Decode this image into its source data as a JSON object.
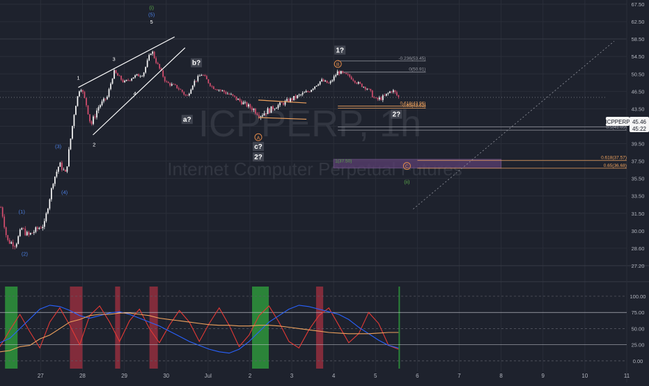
{
  "colors": {
    "background": "#1e222d",
    "grid": "#2a2e39",
    "up_candle": "#f7f7f7",
    "down_candle": "#d24d6d",
    "wave_line": "#ffffff",
    "fib_line": "#9598a1",
    "fib_orange": "#f0a35e",
    "target_box": "#5a3f72",
    "blue_wave_label": "#4a7ee0",
    "green_wave_label": "#5ba84a",
    "orange_wave_label": "#e08a4a",
    "osc_red": "#e53935",
    "osc_blue": "#2962ff",
    "osc_orange": "#f0a35e",
    "osc_band_green": "#2e9e3c",
    "osc_band_red": "#9b2f3f",
    "osc_band_gray": "#7a7d88",
    "price_tag_bg": "#f5f5f5"
  },
  "watermark": {
    "symbol": "ICPPERP, 1h",
    "description": "Internet Computer Perpetual Futures"
  },
  "price_tag": {
    "symbol": "ICPPERP",
    "price": "45.46",
    "countdown": "45:22"
  },
  "chart_data": [
    {
      "type": "candlestick",
      "pane": "main",
      "ylim": [
        27.2,
        67.5
      ],
      "y_ticks": [
        27.2,
        28.6,
        30.0,
        31.5,
        33.5,
        35.5,
        37.5,
        39.5,
        41.5,
        43.5,
        46.5,
        50.5,
        54.5,
        58.5,
        62.5,
        67.5
      ],
      "y_tick_labels": [
        "27.20",
        "28.60",
        "30.00",
        "31.50",
        "33.50",
        "35.50",
        "37.50",
        "39.50",
        "41.50",
        "43.50",
        "46.50",
        "50.50",
        "54.50",
        "58.50",
        "62.50",
        "67.50"
      ],
      "x_tick_labels": [
        "27",
        "28",
        "29",
        "30",
        "Jul",
        "2",
        "3",
        "4",
        "5",
        "6",
        "7",
        "8",
        "9",
        "10",
        "11"
      ],
      "x_tick_days": [
        0,
        1,
        2,
        3,
        4,
        5,
        6,
        7,
        8,
        9,
        10,
        11,
        12,
        13,
        14
      ],
      "x_range_days": [
        -0.97,
        14.0
      ],
      "price_path": [
        {
          "day": -0.95,
          "price": 32.2
        },
        {
          "day": -0.8,
          "price": 29.2
        },
        {
          "day": -0.6,
          "price": 28.9
        },
        {
          "day": -0.45,
          "price": 30.2
        },
        {
          "day": -0.3,
          "price": 29.6
        },
        {
          "day": -0.1,
          "price": 30.1
        },
        {
          "day": 0.1,
          "price": 30.6
        },
        {
          "day": 0.3,
          "price": 35.2
        },
        {
          "day": 0.45,
          "price": 37.2
        },
        {
          "day": 0.6,
          "price": 36.0
        },
        {
          "day": 0.8,
          "price": 43.0
        },
        {
          "day": 0.95,
          "price": 47.6
        },
        {
          "day": 1.2,
          "price": 41.6
        },
        {
          "day": 1.4,
          "price": 44.0
        },
        {
          "day": 1.6,
          "price": 45.6
        },
        {
          "day": 1.75,
          "price": 51.0
        },
        {
          "day": 2.0,
          "price": 48.5
        },
        {
          "day": 2.2,
          "price": 49.8
        },
        {
          "day": 2.45,
          "price": 50.5
        },
        {
          "day": 2.65,
          "price": 56.0
        },
        {
          "day": 2.75,
          "price": 53.5
        },
        {
          "day": 3.0,
          "price": 48.5
        },
        {
          "day": 3.25,
          "price": 47.5
        },
        {
          "day": 3.5,
          "price": 45.5
        },
        {
          "day": 3.65,
          "price": 48.5
        },
        {
          "day": 3.85,
          "price": 50.5
        },
        {
          "day": 4.1,
          "price": 47.5
        },
        {
          "day": 4.5,
          "price": 46.0
        },
        {
          "day": 4.9,
          "price": 44.2
        },
        {
          "day": 5.25,
          "price": 42.8
        },
        {
          "day": 5.5,
          "price": 43.5
        },
        {
          "day": 5.8,
          "price": 44.5
        },
        {
          "day": 6.1,
          "price": 45.5
        },
        {
          "day": 6.4,
          "price": 46.5
        },
        {
          "day": 6.7,
          "price": 49.0
        },
        {
          "day": 6.9,
          "price": 48.2
        },
        {
          "day": 7.1,
          "price": 51.0
        },
        {
          "day": 7.4,
          "price": 49.8
        },
        {
          "day": 7.6,
          "price": 48.2
        },
        {
          "day": 7.8,
          "price": 47.2
        },
        {
          "day": 8.0,
          "price": 45.0
        },
        {
          "day": 8.2,
          "price": 45.5
        },
        {
          "day": 8.4,
          "price": 46.8
        },
        {
          "day": 8.55,
          "price": 45.46
        }
      ],
      "wave_labels": [
        {
          "text": "(1)",
          "day": -0.45,
          "price": 31.5,
          "color_key": "blue_wave_label"
        },
        {
          "text": "(2)",
          "day": -0.38,
          "price": 28.0,
          "color_key": "blue_wave_label"
        },
        {
          "text": "(3)",
          "day": 0.42,
          "price": 39.0,
          "color_key": "blue_wave_label"
        },
        {
          "text": "(4)",
          "day": 0.57,
          "price": 33.7,
          "color_key": "blue_wave_label"
        },
        {
          "text": "(5)",
          "day": 2.65,
          "price": 64.0,
          "color_key": "blue_wave_label"
        },
        {
          "text": "(i)",
          "day": 2.65,
          "price": 66.0,
          "color_key": "green_wave_label"
        },
        {
          "text": "1",
          "day": 0.9,
          "price": 49.2,
          "color_key": "wave_line"
        },
        {
          "text": "2",
          "day": 1.28,
          "price": 39.2,
          "color_key": "wave_line"
        },
        {
          "text": "3",
          "day": 1.75,
          "price": 53.5,
          "color_key": "wave_line"
        },
        {
          "text": "4",
          "day": 2.25,
          "price": 45.8,
          "color_key": "wave_line"
        },
        {
          "text": "5",
          "day": 2.65,
          "price": 62.0,
          "color_key": "wave_line"
        },
        {
          "text": "A",
          "day": 5.2,
          "price": 40.0,
          "color_key": "orange_wave_label",
          "circled": true
        },
        {
          "text": "B",
          "day": 7.1,
          "price": 52.3,
          "color_key": "orange_wave_label",
          "circled": true
        },
        {
          "text": "C",
          "day": 8.75,
          "price": 36.7,
          "color_key": "orange_wave_label",
          "circled": true
        },
        {
          "text": "(ii)",
          "day": 8.75,
          "price": 34.9,
          "color_key": "green_wave_label"
        }
      ],
      "boxed_labels": [
        {
          "text": "a?",
          "day": 3.5,
          "price": 42.0
        },
        {
          "text": "b?",
          "day": 3.72,
          "price": 52.5
        },
        {
          "text": "c?",
          "day": 5.2,
          "price": 38.9
        },
        {
          "text": "2?",
          "day": 5.2,
          "price": 37.7
        },
        {
          "text": "1?",
          "day": 7.15,
          "price": 55.4
        },
        {
          "text": "2?",
          "day": 8.5,
          "price": 42.6
        }
      ],
      "fib_levels": [
        {
          "label": "-0.236(53.45)",
          "price": 53.45,
          "day_start": 7.1,
          "day_end": 9.2,
          "color_key": "fib_line"
        },
        {
          "label": "0(50.91)",
          "price": 50.91,
          "day_start": 7.1,
          "day_end": 9.2,
          "color_key": "fib_line"
        },
        {
          "label": "0.618(43.96)",
          "price": 43.96,
          "day_start": 7.1,
          "day_end": 9.2,
          "color_key": "fib_orange"
        },
        {
          "label": "0.65(43.62)",
          "price": 43.62,
          "day_start": 7.1,
          "day_end": 9.2,
          "color_key": "fib_orange"
        },
        {
          "label": "1(41.43)",
          "price": 41.43,
          "day_start": 7.1,
          "day_end": 14.0,
          "color_key": "fib_line"
        },
        {
          "label": "0.5(41.05)",
          "price": 41.05,
          "day_start": 7.1,
          "day_end": 14.0,
          "color_key": "fib_line"
        },
        {
          "label": "0.618(37.57)",
          "price": 37.57,
          "day_start": 9.0,
          "day_end": 14.0,
          "color_key": "fib_orange"
        },
        {
          "label": "0.65(36.68)",
          "price": 36.68,
          "day_start": 9.0,
          "day_end": 14.0,
          "color_key": "fib_orange"
        },
        {
          "label": "1(37.50)",
          "price": 37.2,
          "day_start": 7.0,
          "day_end": 7.0,
          "color_key": "green_wave_label"
        }
      ],
      "target_box": {
        "day_start": 7.0,
        "day_end": 11.0,
        "price_top": 37.7,
        "price_bottom": 36.7
      },
      "trend_lines": [
        {
          "from": {
            "day": 0.9,
            "price": 47.4
          },
          "to": {
            "day": 3.2,
            "price": 59.0
          },
          "color_key": "wave_line"
        },
        {
          "from": {
            "day": 1.25,
            "price": 40.5
          },
          "to": {
            "day": 3.45,
            "price": 56.5
          },
          "color_key": "wave_line"
        },
        {
          "from": {
            "day": 5.2,
            "price": 45.0
          },
          "to": {
            "day": 6.35,
            "price": 44.5
          },
          "color_key": "fib_orange"
        },
        {
          "from": {
            "day": 5.2,
            "price": 42.5
          },
          "to": {
            "day": 6.35,
            "price": 42.3
          },
          "color_key": "fib_orange"
        },
        {
          "from": {
            "day": 8.9,
            "price": 32.0
          },
          "to": {
            "day": 13.7,
            "price": 58.0
          },
          "color_key": "fib_line",
          "dashed": true
        }
      ]
    },
    {
      "type": "line",
      "pane": "oscillator",
      "ylim": [
        -12,
        115
      ],
      "y_ticks": [
        0,
        25,
        50,
        75,
        100
      ],
      "y_tick_labels": [
        "0.00",
        "25.00",
        "50.00",
        "75.00",
        "100.00"
      ],
      "series": [
        {
          "color_key": "osc_red",
          "values": [
            22,
            48,
            72,
            45,
            20,
            60,
            82,
            55,
            25,
            70,
            85,
            60,
            30,
            62,
            80,
            50,
            28,
            55,
            78,
            60,
            30,
            58,
            82,
            55,
            22,
            40,
            70,
            85,
            60,
            30,
            20,
            48,
            70,
            82,
            55,
            28,
            42,
            75,
            58,
            24,
            18
          ]
        },
        {
          "color_key": "osc_blue",
          "values": [
            28,
            35,
            50,
            65,
            80,
            86,
            84,
            78,
            70,
            66,
            70,
            74,
            76,
            72,
            66,
            60,
            54,
            46,
            38,
            30,
            24,
            18,
            14,
            12,
            18,
            30,
            45,
            60,
            70,
            80,
            86,
            84,
            80,
            76,
            72,
            64,
            52,
            42,
            32,
            24,
            20
          ]
        },
        {
          "color_key": "osc_orange",
          "values": [
            14,
            16,
            22,
            24,
            34,
            40,
            50,
            60,
            64,
            70,
            72,
            72,
            74,
            74,
            72,
            70,
            66,
            64,
            62,
            60,
            58,
            56,
            55,
            55,
            54,
            54,
            55,
            55,
            54,
            52,
            50,
            48,
            46,
            44,
            43,
            42,
            42,
            42,
            43,
            44,
            44
          ]
        }
      ],
      "bands": [
        {
          "day_start": -0.85,
          "day_end": -0.55,
          "color_key": "osc_band_green"
        },
        {
          "day_start": 0.7,
          "day_end": 1.0,
          "color_key": "osc_band_red"
        },
        {
          "day_start": 1.78,
          "day_end": 1.9,
          "color_key": "osc_band_red"
        },
        {
          "day_start": 2.6,
          "day_end": 2.8,
          "color_key": "osc_band_red"
        },
        {
          "day_start": 5.05,
          "day_end": 5.45,
          "color_key": "osc_band_green"
        },
        {
          "day_start": 6.58,
          "day_end": 6.75,
          "color_key": "osc_band_red"
        },
        {
          "day_start": 8.55,
          "day_end": 8.58,
          "color_key": "osc_band_green"
        }
      ]
    }
  ]
}
